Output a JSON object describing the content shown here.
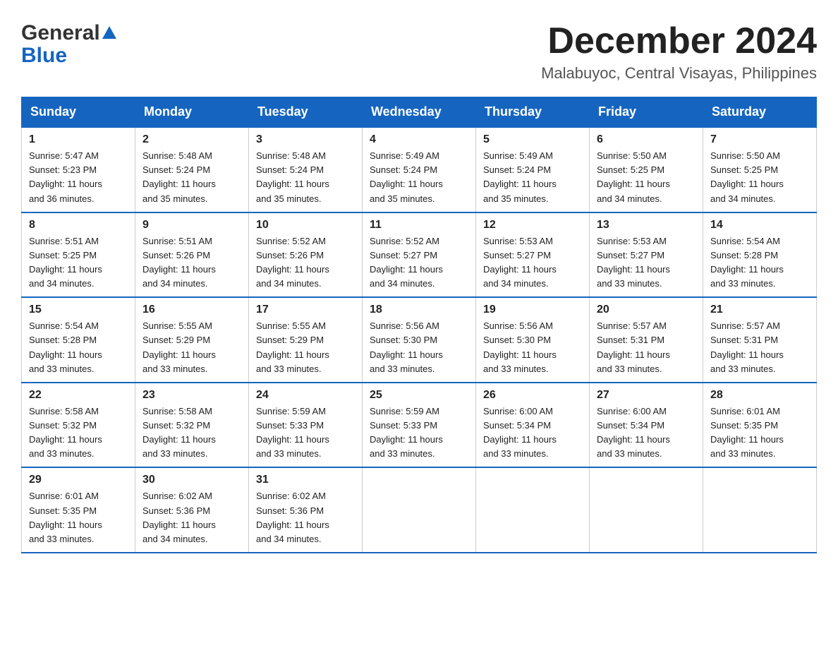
{
  "header": {
    "logo_general": "General",
    "logo_blue": "Blue",
    "month_title": "December 2024",
    "location": "Malabuyoc, Central Visayas, Philippines"
  },
  "days_of_week": [
    "Sunday",
    "Monday",
    "Tuesday",
    "Wednesday",
    "Thursday",
    "Friday",
    "Saturday"
  ],
  "weeks": [
    [
      {
        "day": "1",
        "sunrise": "5:47 AM",
        "sunset": "5:23 PM",
        "daylight": "11 hours and 36 minutes."
      },
      {
        "day": "2",
        "sunrise": "5:48 AM",
        "sunset": "5:24 PM",
        "daylight": "11 hours and 35 minutes."
      },
      {
        "day": "3",
        "sunrise": "5:48 AM",
        "sunset": "5:24 PM",
        "daylight": "11 hours and 35 minutes."
      },
      {
        "day": "4",
        "sunrise": "5:49 AM",
        "sunset": "5:24 PM",
        "daylight": "11 hours and 35 minutes."
      },
      {
        "day": "5",
        "sunrise": "5:49 AM",
        "sunset": "5:24 PM",
        "daylight": "11 hours and 35 minutes."
      },
      {
        "day": "6",
        "sunrise": "5:50 AM",
        "sunset": "5:25 PM",
        "daylight": "11 hours and 34 minutes."
      },
      {
        "day": "7",
        "sunrise": "5:50 AM",
        "sunset": "5:25 PM",
        "daylight": "11 hours and 34 minutes."
      }
    ],
    [
      {
        "day": "8",
        "sunrise": "5:51 AM",
        "sunset": "5:25 PM",
        "daylight": "11 hours and 34 minutes."
      },
      {
        "day": "9",
        "sunrise": "5:51 AM",
        "sunset": "5:26 PM",
        "daylight": "11 hours and 34 minutes."
      },
      {
        "day": "10",
        "sunrise": "5:52 AM",
        "sunset": "5:26 PM",
        "daylight": "11 hours and 34 minutes."
      },
      {
        "day": "11",
        "sunrise": "5:52 AM",
        "sunset": "5:27 PM",
        "daylight": "11 hours and 34 minutes."
      },
      {
        "day": "12",
        "sunrise": "5:53 AM",
        "sunset": "5:27 PM",
        "daylight": "11 hours and 34 minutes."
      },
      {
        "day": "13",
        "sunrise": "5:53 AM",
        "sunset": "5:27 PM",
        "daylight": "11 hours and 33 minutes."
      },
      {
        "day": "14",
        "sunrise": "5:54 AM",
        "sunset": "5:28 PM",
        "daylight": "11 hours and 33 minutes."
      }
    ],
    [
      {
        "day": "15",
        "sunrise": "5:54 AM",
        "sunset": "5:28 PM",
        "daylight": "11 hours and 33 minutes."
      },
      {
        "day": "16",
        "sunrise": "5:55 AM",
        "sunset": "5:29 PM",
        "daylight": "11 hours and 33 minutes."
      },
      {
        "day": "17",
        "sunrise": "5:55 AM",
        "sunset": "5:29 PM",
        "daylight": "11 hours and 33 minutes."
      },
      {
        "day": "18",
        "sunrise": "5:56 AM",
        "sunset": "5:30 PM",
        "daylight": "11 hours and 33 minutes."
      },
      {
        "day": "19",
        "sunrise": "5:56 AM",
        "sunset": "5:30 PM",
        "daylight": "11 hours and 33 minutes."
      },
      {
        "day": "20",
        "sunrise": "5:57 AM",
        "sunset": "5:31 PM",
        "daylight": "11 hours and 33 minutes."
      },
      {
        "day": "21",
        "sunrise": "5:57 AM",
        "sunset": "5:31 PM",
        "daylight": "11 hours and 33 minutes."
      }
    ],
    [
      {
        "day": "22",
        "sunrise": "5:58 AM",
        "sunset": "5:32 PM",
        "daylight": "11 hours and 33 minutes."
      },
      {
        "day": "23",
        "sunrise": "5:58 AM",
        "sunset": "5:32 PM",
        "daylight": "11 hours and 33 minutes."
      },
      {
        "day": "24",
        "sunrise": "5:59 AM",
        "sunset": "5:33 PM",
        "daylight": "11 hours and 33 minutes."
      },
      {
        "day": "25",
        "sunrise": "5:59 AM",
        "sunset": "5:33 PM",
        "daylight": "11 hours and 33 minutes."
      },
      {
        "day": "26",
        "sunrise": "6:00 AM",
        "sunset": "5:34 PM",
        "daylight": "11 hours and 33 minutes."
      },
      {
        "day": "27",
        "sunrise": "6:00 AM",
        "sunset": "5:34 PM",
        "daylight": "11 hours and 33 minutes."
      },
      {
        "day": "28",
        "sunrise": "6:01 AM",
        "sunset": "5:35 PM",
        "daylight": "11 hours and 33 minutes."
      }
    ],
    [
      {
        "day": "29",
        "sunrise": "6:01 AM",
        "sunset": "5:35 PM",
        "daylight": "11 hours and 33 minutes."
      },
      {
        "day": "30",
        "sunrise": "6:02 AM",
        "sunset": "5:36 PM",
        "daylight": "11 hours and 34 minutes."
      },
      {
        "day": "31",
        "sunrise": "6:02 AM",
        "sunset": "5:36 PM",
        "daylight": "11 hours and 34 minutes."
      },
      null,
      null,
      null,
      null
    ]
  ],
  "labels": {
    "sunrise": "Sunrise:",
    "sunset": "Sunset:",
    "daylight": "Daylight:"
  }
}
